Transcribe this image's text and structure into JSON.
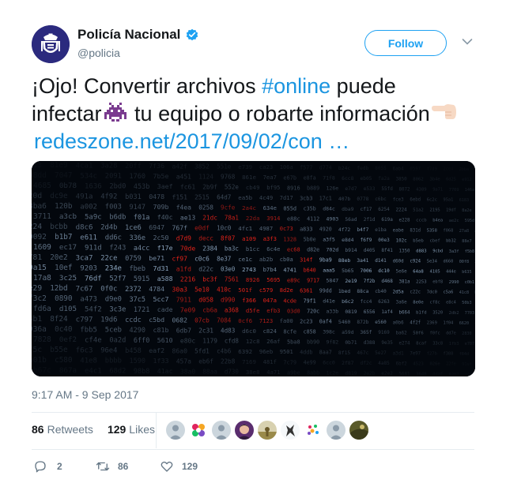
{
  "header": {
    "display_name": "Policía Nacional",
    "handle": "@policia",
    "follow_label": "Follow"
  },
  "tweet": {
    "text_line1_prefix": "¡Ojo! Convertir archivos ",
    "hashtag": "#online",
    "text_line1_suffix": " puede",
    "text_line2a": "infectar",
    "text_line2b": " tu equipo o robarte información",
    "link": "redeszone.net/2017/09/02/con  …",
    "emojis": [
      "space-invader-emoji",
      "pointing-left-hand-emoji"
    ]
  },
  "timestamp": "9:17 AM - 9 Sep 2017",
  "stats": {
    "retweets_count": "86",
    "retweets_label": "Retweets",
    "likes_count": "129",
    "likes_label": "Likes"
  },
  "actions": {
    "reply_count": "2",
    "retweet_count": "86",
    "like_count": "129"
  },
  "colors": {
    "accent": "#1da1f2",
    "link": "#1b95e0",
    "muted": "#657786",
    "verified": "#1da1f2"
  }
}
